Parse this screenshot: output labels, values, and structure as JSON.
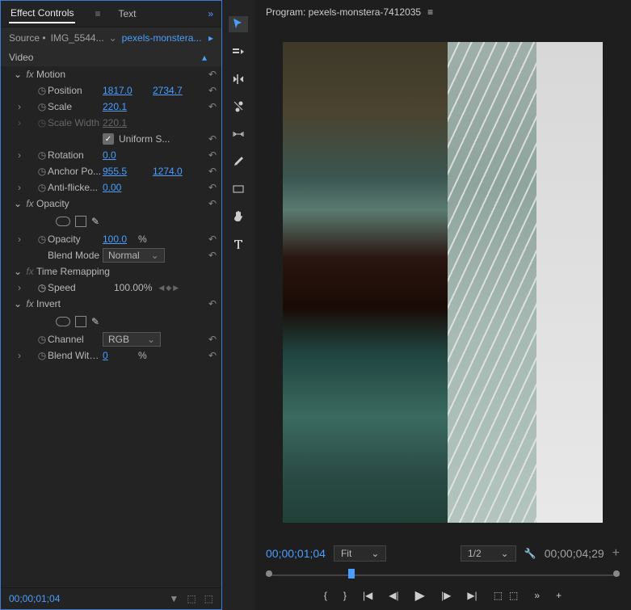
{
  "tabs": {
    "effect_controls": "Effect Controls",
    "text": "Text"
  },
  "source": {
    "prefix": "Source •",
    "clip": "IMG_5544...",
    "seq": "pexels-monstera..."
  },
  "video_label": "Video",
  "motion": {
    "title": "Motion",
    "position": "Position",
    "pos_x": "1817.0",
    "pos_y": "2734.7",
    "scale": "Scale",
    "scale_v": "220.1",
    "scale_w": "Scale Width",
    "scale_wv": "220.1",
    "uniform": "Uniform S...",
    "rotation": "Rotation",
    "rot_v": "0.0",
    "anchor": "Anchor Po...",
    "ax": "955.5",
    "ay": "1274.0",
    "antiflicker": "Anti-flicke...",
    "af_v": "0.00"
  },
  "opacity": {
    "title": "Opacity",
    "label": "Opacity",
    "val": "100.0",
    "pct": "%",
    "blend": "Blend Mode",
    "normal": "Normal"
  },
  "time": {
    "title": "Time Remapping",
    "speed": "Speed",
    "val": "100.00%"
  },
  "invert": {
    "title": "Invert",
    "channel": "Channel",
    "rgb": "RGB",
    "blend": "Blend With...",
    "val": "0",
    "pct": "%"
  },
  "timecode": "00;00;01;04",
  "program": {
    "title": "Program: pexels-monstera-7412035",
    "tc": "00;00;01;04",
    "fit": "Fit",
    "res": "1/2",
    "dur": "00;00;04;29"
  }
}
